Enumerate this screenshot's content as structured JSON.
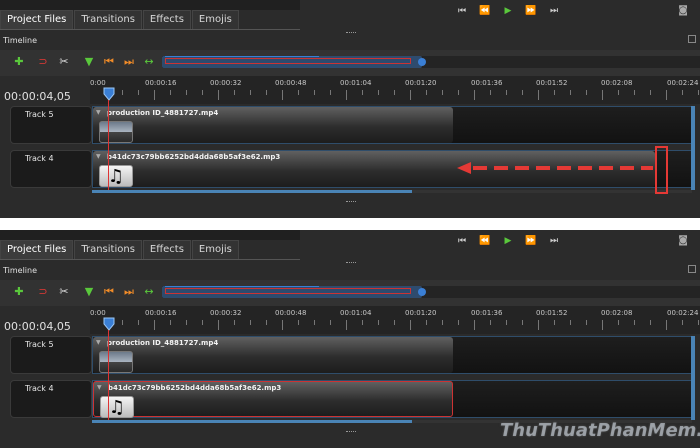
{
  "tabs": [
    "Project Files",
    "Transitions",
    "Effects",
    "Emojis"
  ],
  "transport_icons": [
    "skip-back-icon",
    "rewind-icon",
    "play-icon",
    "fast-forward-icon",
    "skip-forward-icon"
  ],
  "transport_glyphs": [
    "⏮",
    "⏪",
    "▶",
    "⏩",
    "⏭"
  ],
  "timeline_label": "Timeline",
  "time_display": "00:00:04,05",
  "ruler_ticks": [
    "0:00",
    "00:00:16",
    "00:00:32",
    "00:00:48",
    "00:01:04",
    "00:01:20",
    "00:01:36",
    "00:01:52",
    "00:02:08",
    "00:02:24"
  ],
  "tracks": [
    {
      "name": "Track 5",
      "clip_title": "production ID_4881727.mp4",
      "kind": "video"
    },
    {
      "name": "Track 4",
      "clip_title": "b41dc73c79bb6252bd4dda68b5af3e62.mp3",
      "kind": "audio"
    }
  ],
  "audio_glyph": "♫",
  "watermark": "ThuThuatPhanMem.vn",
  "colors": {
    "accent_blue": "#3a7fd5",
    "play_green": "#5ac83c",
    "highlight_red": "#e53935",
    "panel_bg": "#2b2b2b"
  }
}
